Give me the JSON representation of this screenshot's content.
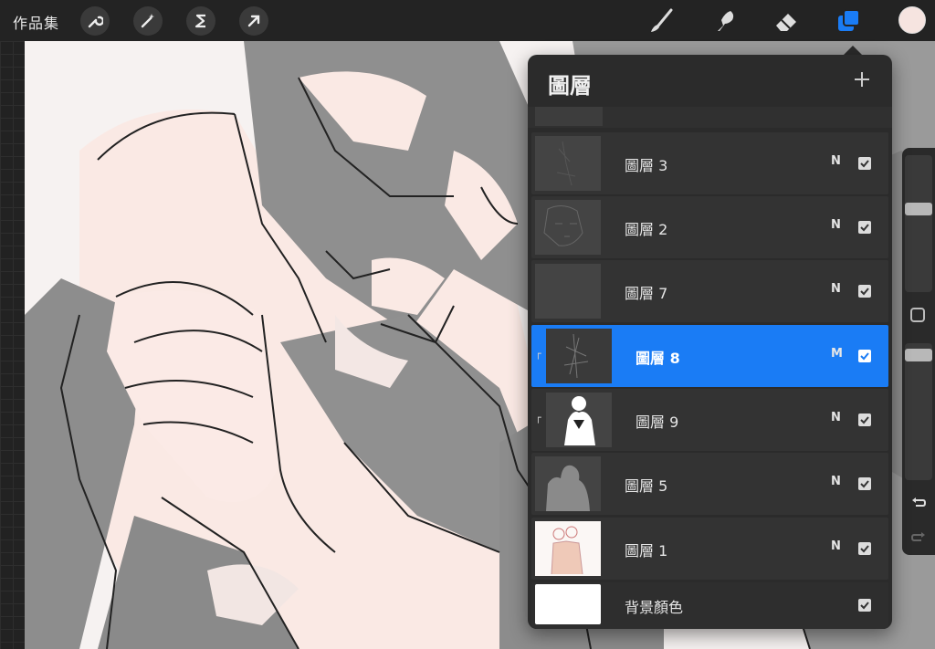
{
  "topbar": {
    "gallery_label": "作品集",
    "left_tools": [
      "wrench-icon",
      "magic-wand-icon",
      "selection-s-icon",
      "transform-arrow-icon"
    ],
    "right_tools": [
      "brush-icon",
      "smudge-icon",
      "eraser-icon",
      "layers-icon"
    ],
    "color_swatch": "#f6e4e0",
    "active_tool_color": "#1a7cf5"
  },
  "layers_panel": {
    "title": "圖層",
    "add_icon": "plus-icon",
    "layers": [
      {
        "name": "圖層 3",
        "blend": "N",
        "visible": true,
        "selected": false,
        "clipped": false
      },
      {
        "name": "圖層 2",
        "blend": "N",
        "visible": true,
        "selected": false,
        "clipped": false
      },
      {
        "name": "圖層 7",
        "blend": "N",
        "visible": true,
        "selected": false,
        "clipped": false
      },
      {
        "name": "圖層 8",
        "blend": "M",
        "visible": true,
        "selected": true,
        "clipped": true
      },
      {
        "name": "圖層 9",
        "blend": "N",
        "visible": true,
        "selected": false,
        "clipped": true
      },
      {
        "name": "圖層 5",
        "blend": "N",
        "visible": true,
        "selected": false,
        "clipped": false
      },
      {
        "name": "圖層 1",
        "blend": "N",
        "visible": true,
        "selected": false,
        "clipped": false
      }
    ],
    "background": {
      "name": "背景顏色",
      "visible": true
    }
  },
  "sidebar": {
    "modify_icon": "square-icon",
    "undo_icon": "undo-icon",
    "redo_icon": "redo-icon"
  }
}
